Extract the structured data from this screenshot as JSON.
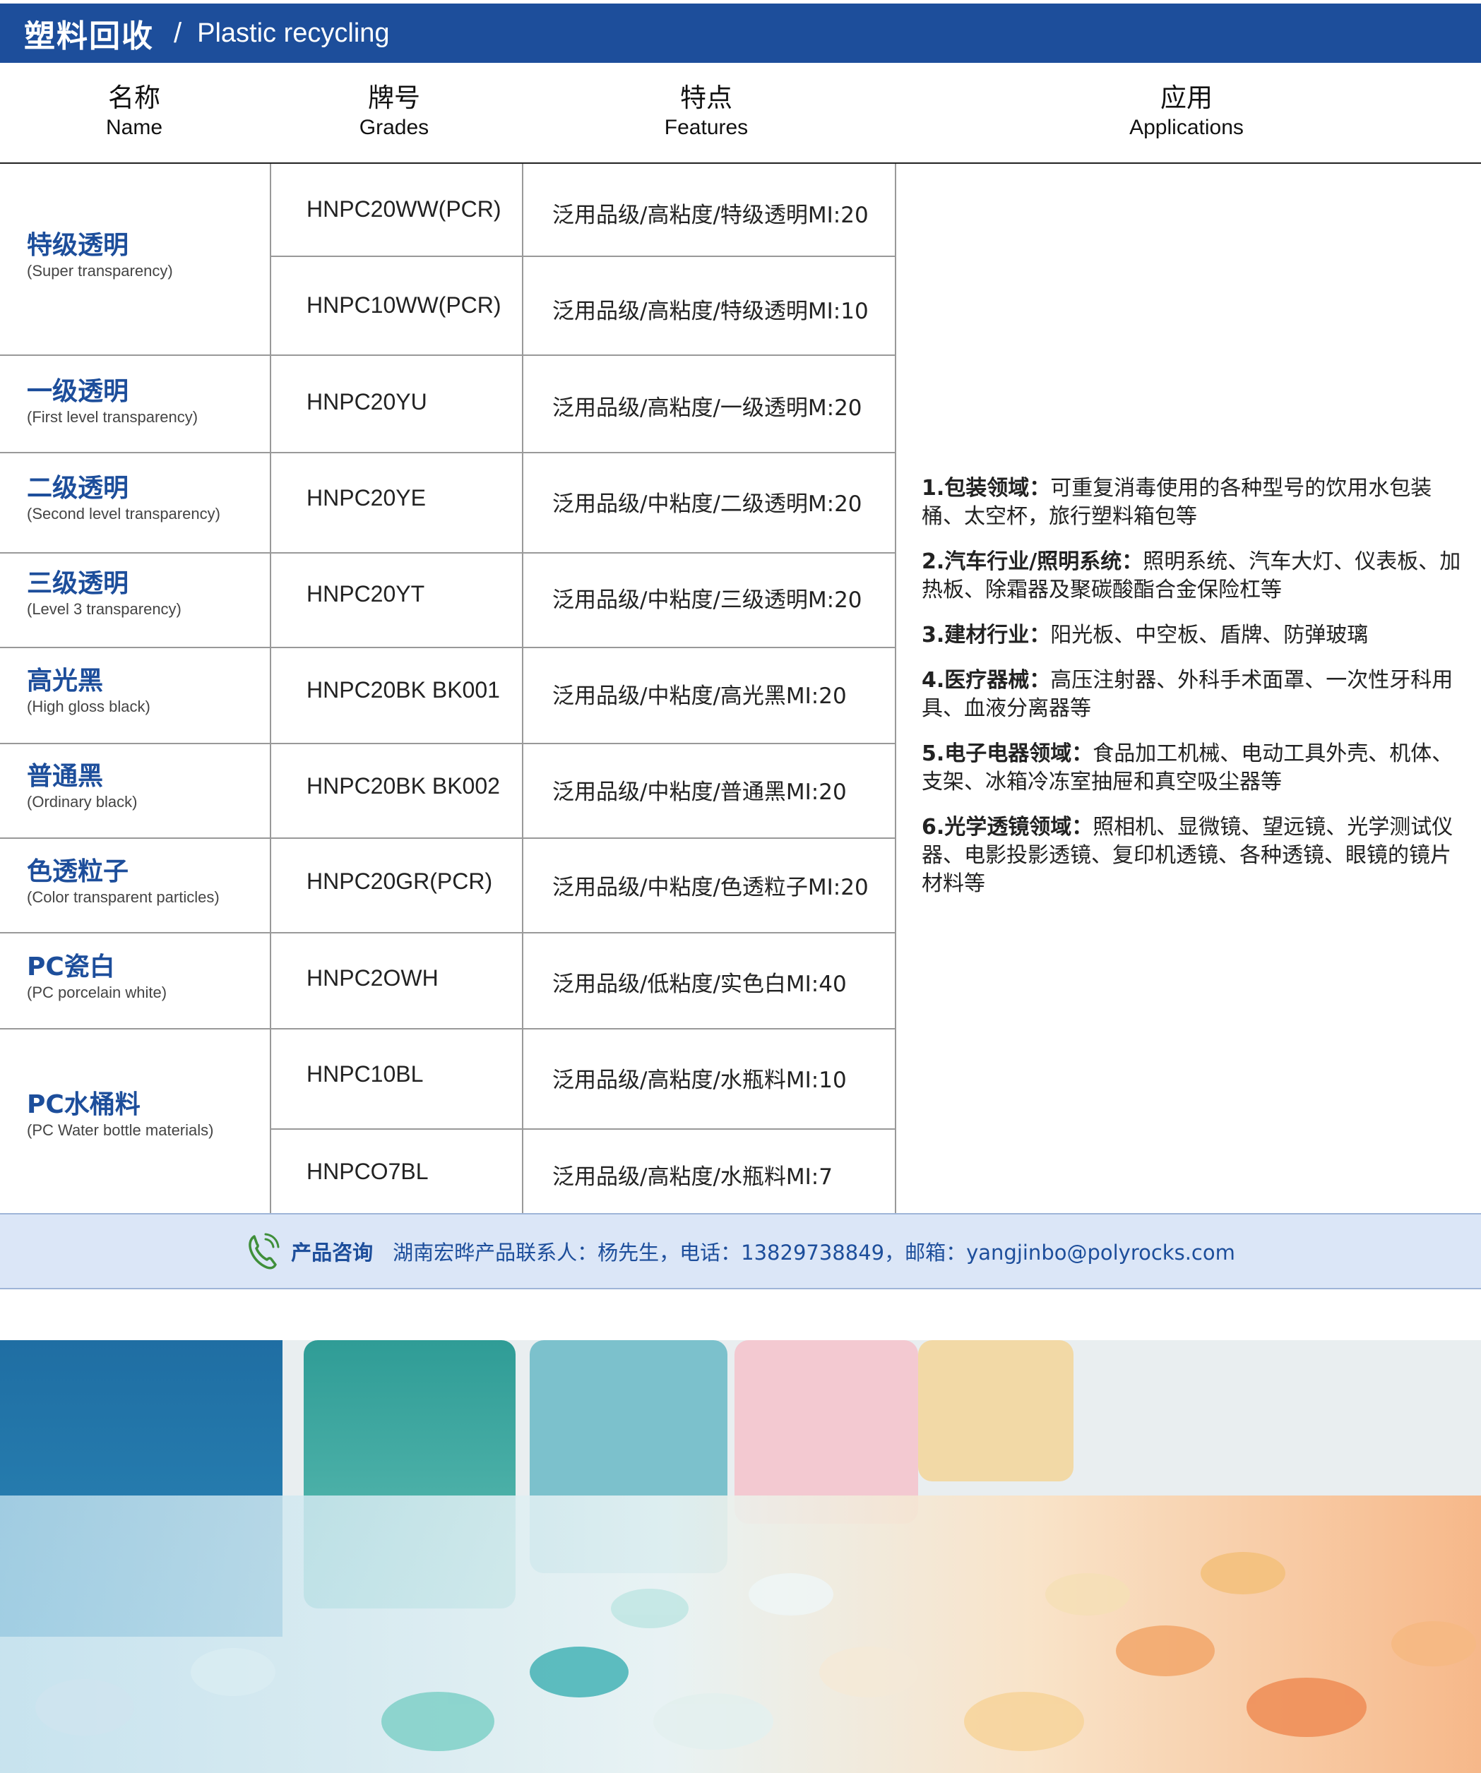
{
  "header": {
    "title_zh": "塑料回收",
    "separator": "/",
    "title_en": "Plastic recycling"
  },
  "columns": [
    {
      "zh": "名称",
      "en": "Name"
    },
    {
      "zh": "牌号",
      "en": "Grades"
    },
    {
      "zh": "特点",
      "en": "Features"
    },
    {
      "zh": "应用",
      "en": "Applications"
    }
  ],
  "products": [
    {
      "name_zh": "特级透明",
      "name_en": "(Super transparency)"
    },
    {
      "name_zh": "一级透明",
      "name_en": "(First level transparency)"
    },
    {
      "name_zh": "二级透明",
      "name_en": "(Second level transparency)"
    },
    {
      "name_zh": "三级透明",
      "name_en": "(Level 3 transparency)"
    },
    {
      "name_zh": "高光黑",
      "name_en": "(High gloss black)"
    },
    {
      "name_zh": "普通黑",
      "name_en": "(Ordinary black)"
    },
    {
      "name_zh": "色透粒子",
      "name_en": "(Color transparent particles)"
    },
    {
      "name_zh": "PC瓷白",
      "name_en": "(PC porcelain white)"
    },
    {
      "name_zh": "PC水桶料",
      "name_en": "(PC Water bottle materials)"
    }
  ],
  "grades": [
    {
      "grade": "HNPC20WW(PCR)",
      "feature": "泛用品级/高粘度/特级透明MI:20"
    },
    {
      "grade": "HNPC10WW(PCR)",
      "feature": "泛用品级/高粘度/特级透明MI:10"
    },
    {
      "grade": "HNPC20YU",
      "feature": "泛用品级/高粘度/一级透明M:20"
    },
    {
      "grade": "HNPC20YE",
      "feature": "泛用品级/中粘度/二级透明M:20"
    },
    {
      "grade": "HNPC20YT",
      "feature": "泛用品级/中粘度/三级透明M:20"
    },
    {
      "grade": "HNPC20BK BK001",
      "feature": "泛用品级/中粘度/高光黑MI:20"
    },
    {
      "grade": "HNPC20BK BK002",
      "feature": "泛用品级/中粘度/普通黑MI:20"
    },
    {
      "grade": "HNPC20GR(PCR)",
      "feature": "泛用品级/中粘度/色透粒子MI:20"
    },
    {
      "grade": "HNPC2OWH",
      "feature": "泛用品级/低粘度/实色白MI:40"
    },
    {
      "grade": "HNPC10BL",
      "feature": "泛用品级/高粘度/水瓶料MI:10"
    },
    {
      "grade": "HNPCO7BL",
      "feature": "泛用品级/高粘度/水瓶料MI:7"
    }
  ],
  "applications": [
    {
      "title": "1.包装领域：",
      "text": "可重复消毒使用的各种型号的饮用水包装桶、太空杯，旅行塑料箱包等"
    },
    {
      "title": "2.汽车行业/照明系统：",
      "text": "照明系统、汽车大灯、仪表板、加热板、除霜器及聚碳酸酯合金保险杠等"
    },
    {
      "title": "3.建材行业：",
      "text": "阳光板、中空板、盾牌、防弹玻璃"
    },
    {
      "title": "4.医疗器械：",
      "text": "高压注射器、外科手术面罩、一次性牙科用具、血液分离器等"
    },
    {
      "title": "5.电子电器领域：",
      "text": "食品加工机械、电动工具外壳、机体、支架、冰箱冷冻室抽屉和真空吸尘器等"
    },
    {
      "title": "6.光学透镜领域：",
      "text": "照相机、显微镜、望远镜、光学测试仪器、电影投影透镜、复印机透镜、各种透镜、眼镜的镜片材料等"
    }
  ],
  "contact": {
    "label": "产品咨询",
    "text": "湖南宏晔产品联系人：杨先生，电话：13829738849，邮箱：yangjinbo@polyrocks.com",
    "icon": "phone-icon"
  },
  "colors": {
    "brand_blue": "#1d4e9b",
    "contact_bg": "#dbe6f7"
  }
}
